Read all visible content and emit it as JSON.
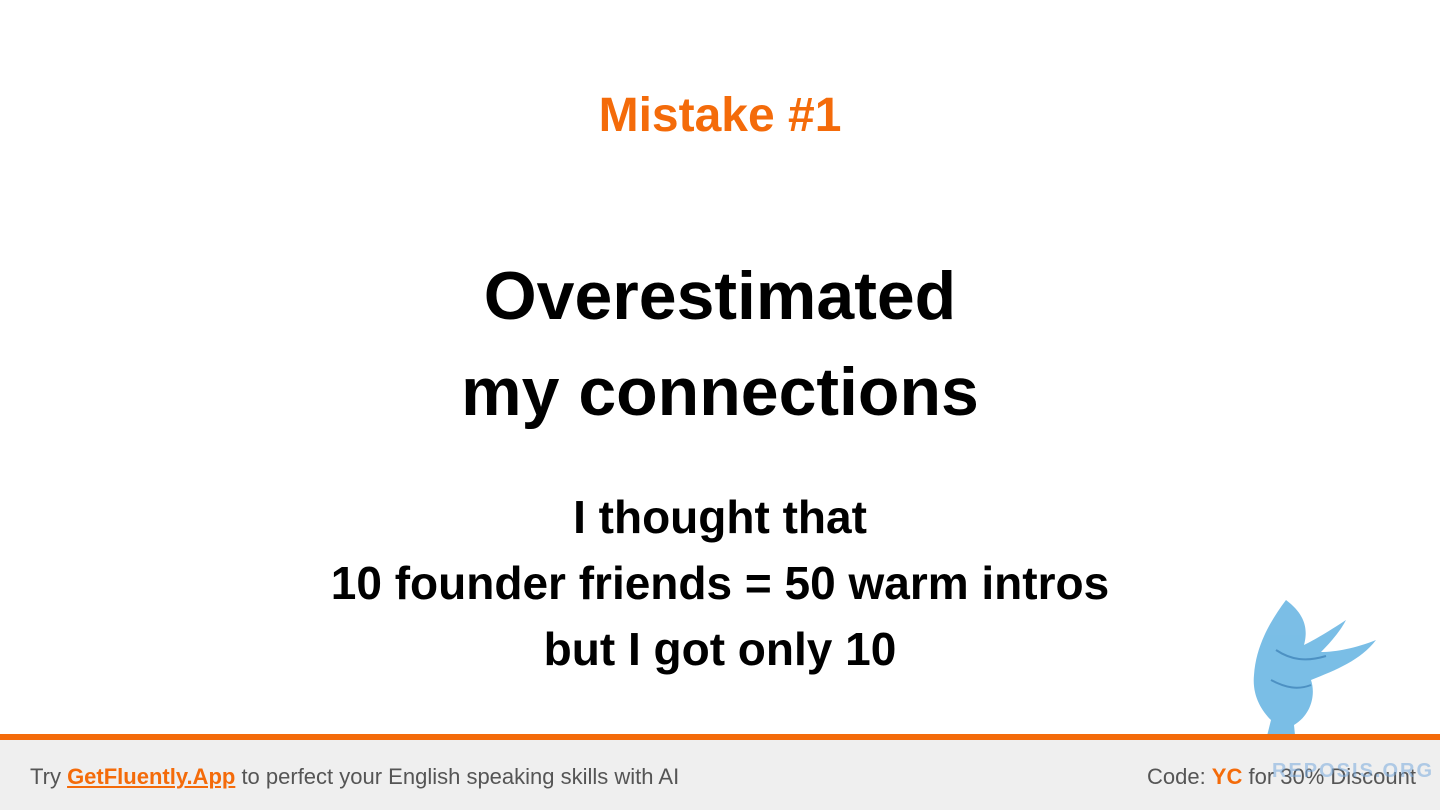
{
  "slide": {
    "eyebrow": "Mistake #1",
    "headline": {
      "line1": "Overestimated",
      "line2": "my connections"
    },
    "body": {
      "line1": "I thought that",
      "line2": "10 founder friends = 50 warm intros",
      "line3": "but I got only 10"
    }
  },
  "footer": {
    "left": {
      "prefix": "Try ",
      "link": "GetFluently.App",
      "suffix": " to perfect your English speaking skills with AI"
    },
    "right": {
      "prefix": "Code: ",
      "code": "YC",
      "suffix": " for 30% Discount"
    }
  },
  "watermark": {
    "icon": "griffin-icon",
    "text": "REPOSIS.ORG"
  },
  "colors": {
    "accent": "#f46b0a",
    "text": "#000000",
    "footer_bg": "#efefef",
    "footer_text": "#555555"
  }
}
